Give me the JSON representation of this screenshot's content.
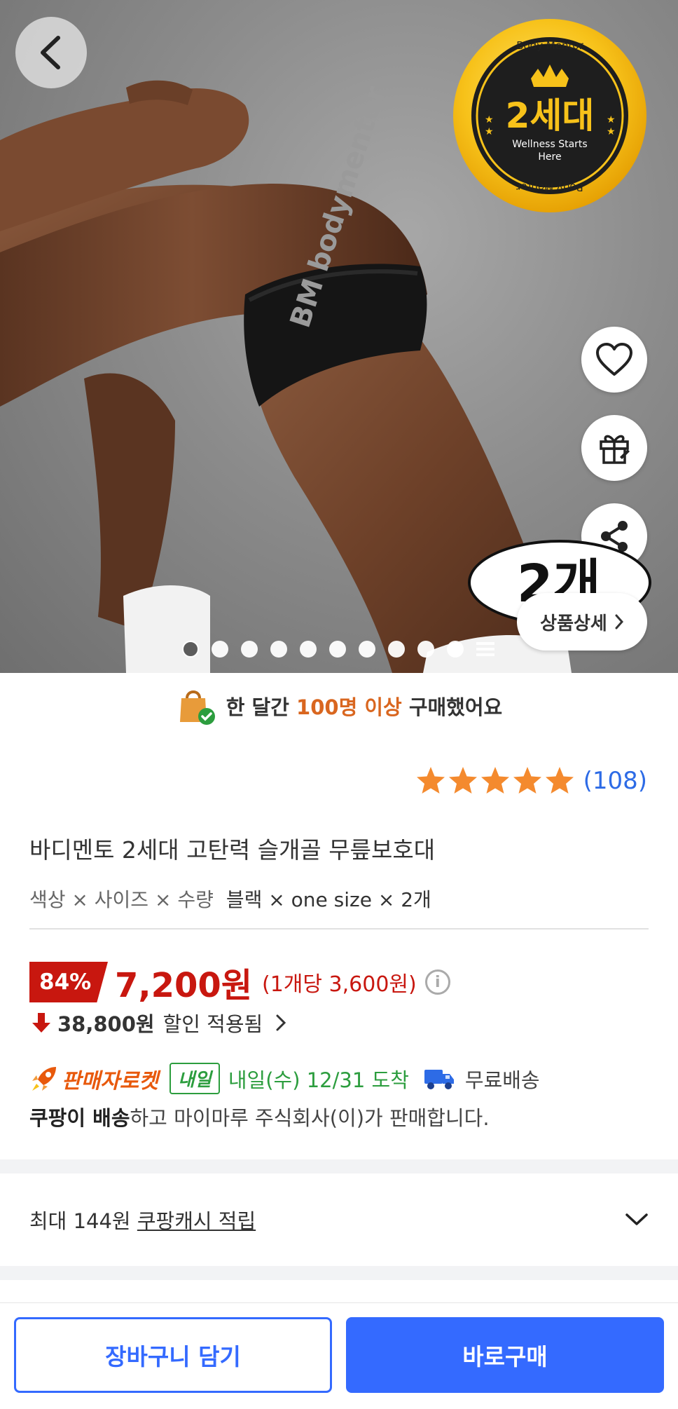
{
  "hero": {
    "badge": {
      "brand_top": "Body Mentor",
      "title": "2세대",
      "tagline_1": "Wellness Starts",
      "tagline_2": "Here",
      "brand_bottom": "Body Mentor"
    },
    "strap_logo": "BM bodymentor",
    "quantity_bubble": "2개",
    "detail_button": "상품상세",
    "image_count": 10,
    "active_image": 1
  },
  "notice": {
    "prefix": "한 달간",
    "highlight": "100명 이상",
    "suffix": "구매했어요"
  },
  "rating": {
    "stars": 5,
    "count": "(108)"
  },
  "product": {
    "title": "바디멘토 2세대 고탄력 슬개골 무릎보호대",
    "option_label": "색상 × 사이즈 × 수량",
    "option_value": "블랙 × one size × 2개"
  },
  "price": {
    "discount": "84%",
    "sale_price": "7,200원",
    "unit_price": "(1개당 3,600원)",
    "original_price": "38,800원",
    "original_label": "할인 적용됨"
  },
  "delivery": {
    "rocket_label": "판매자로켓",
    "tomorrow_badge": "내일",
    "arrival": "내일(수) 12/31 도착",
    "free_shipping": "무료배송"
  },
  "seller": {
    "bold": "쿠팡이 배송",
    "rest": "하고 마이마루 주식회사(이)가 판매합니다."
  },
  "cash": {
    "prefix": "최대 144원",
    "link": "쿠팡캐시 적립"
  },
  "actions": {
    "cart": "장바구니 담기",
    "buy": "바로구매"
  },
  "colors": {
    "accent_blue": "#346aff",
    "price_red": "#c8170f",
    "rocket_orange": "#e8590c",
    "delivery_green": "#2c9d3e",
    "star_orange": "#f48a2e"
  }
}
